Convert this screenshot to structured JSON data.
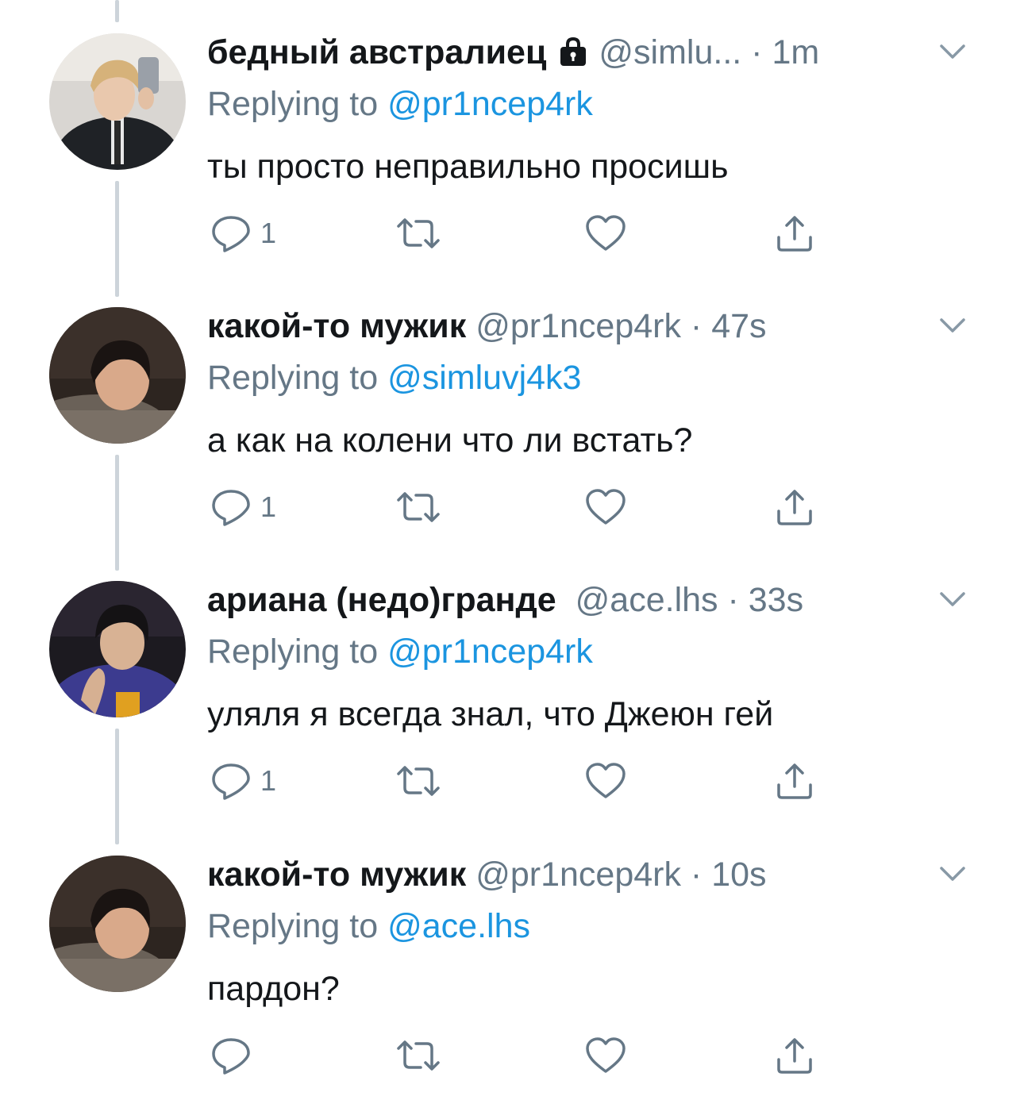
{
  "colors": {
    "text_primary": "#14171a",
    "text_secondary": "#657786",
    "link": "#1b95e0",
    "icon": "#657786",
    "thread_line": "#cdd4da"
  },
  "icons": {
    "reply": "speech-bubble-icon",
    "retweet": "retweet-icon",
    "like": "heart-icon",
    "share": "share-icon",
    "more": "chevron-down-icon",
    "protected": "lock-icon"
  },
  "tweets": [
    {
      "name": "бедный австралиец",
      "protected": true,
      "handle": "@simlu...",
      "time": "1m",
      "replying_label": "Replying to",
      "replying_to": "@pr1ncep4rk",
      "text": "ты просто неправильно просишь",
      "reply_count": "1"
    },
    {
      "name": "какой-то мужик",
      "protected": false,
      "handle": "@pr1ncep4rk",
      "time": "47s",
      "replying_label": "Replying to",
      "replying_to": "@simluvj4k3",
      "text": "а как на колени что ли встать?",
      "reply_count": "1"
    },
    {
      "name": "ариана (недо)гранде",
      "protected": false,
      "handle": "@ace.lhs",
      "time": "33s",
      "replying_label": "Replying to",
      "replying_to": "@pr1ncep4rk",
      "text": "уляля я всегда знал, что Джеюн гей",
      "reply_count": "1"
    },
    {
      "name": "какой-то мужик",
      "protected": false,
      "handle": "@pr1ncep4rk",
      "time": "10s",
      "replying_label": "Replying to",
      "replying_to": "@ace.lhs",
      "text": "пардон?",
      "reply_count": ""
    }
  ]
}
